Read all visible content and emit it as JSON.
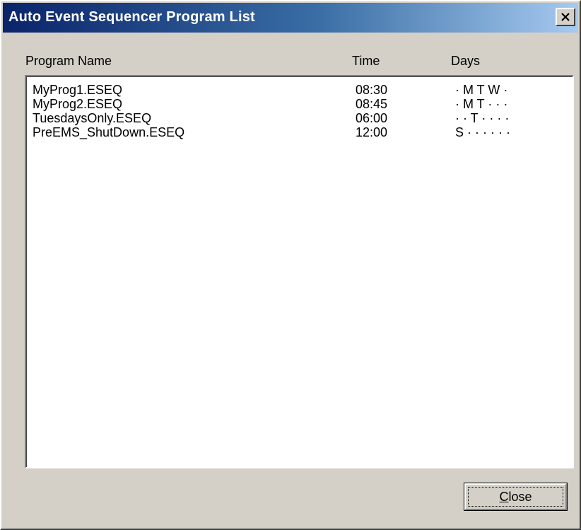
{
  "window": {
    "title": "Auto Event Sequencer Program List"
  },
  "columns": {
    "name": "Program Name",
    "time": "Time",
    "days": "Days"
  },
  "programs": [
    {
      "name": "MyProg1.ESEQ",
      "time": "08:30",
      "days": "· M  T  W ·"
    },
    {
      "name": "MyProg2.ESEQ",
      "time": "08:45",
      "days": "· M  T  · · ·"
    },
    {
      "name": "TuesdaysOnly.ESEQ",
      "time": "06:00",
      "days": "· · T · · · ·"
    },
    {
      "name": "PreEMS_ShutDown.ESEQ",
      "time": "12:00",
      "days": "S · · · · · ·"
    }
  ],
  "buttons": {
    "close_mnemonic": "C",
    "close_rest": "lose"
  },
  "icons": {
    "title_close": "close-icon"
  }
}
